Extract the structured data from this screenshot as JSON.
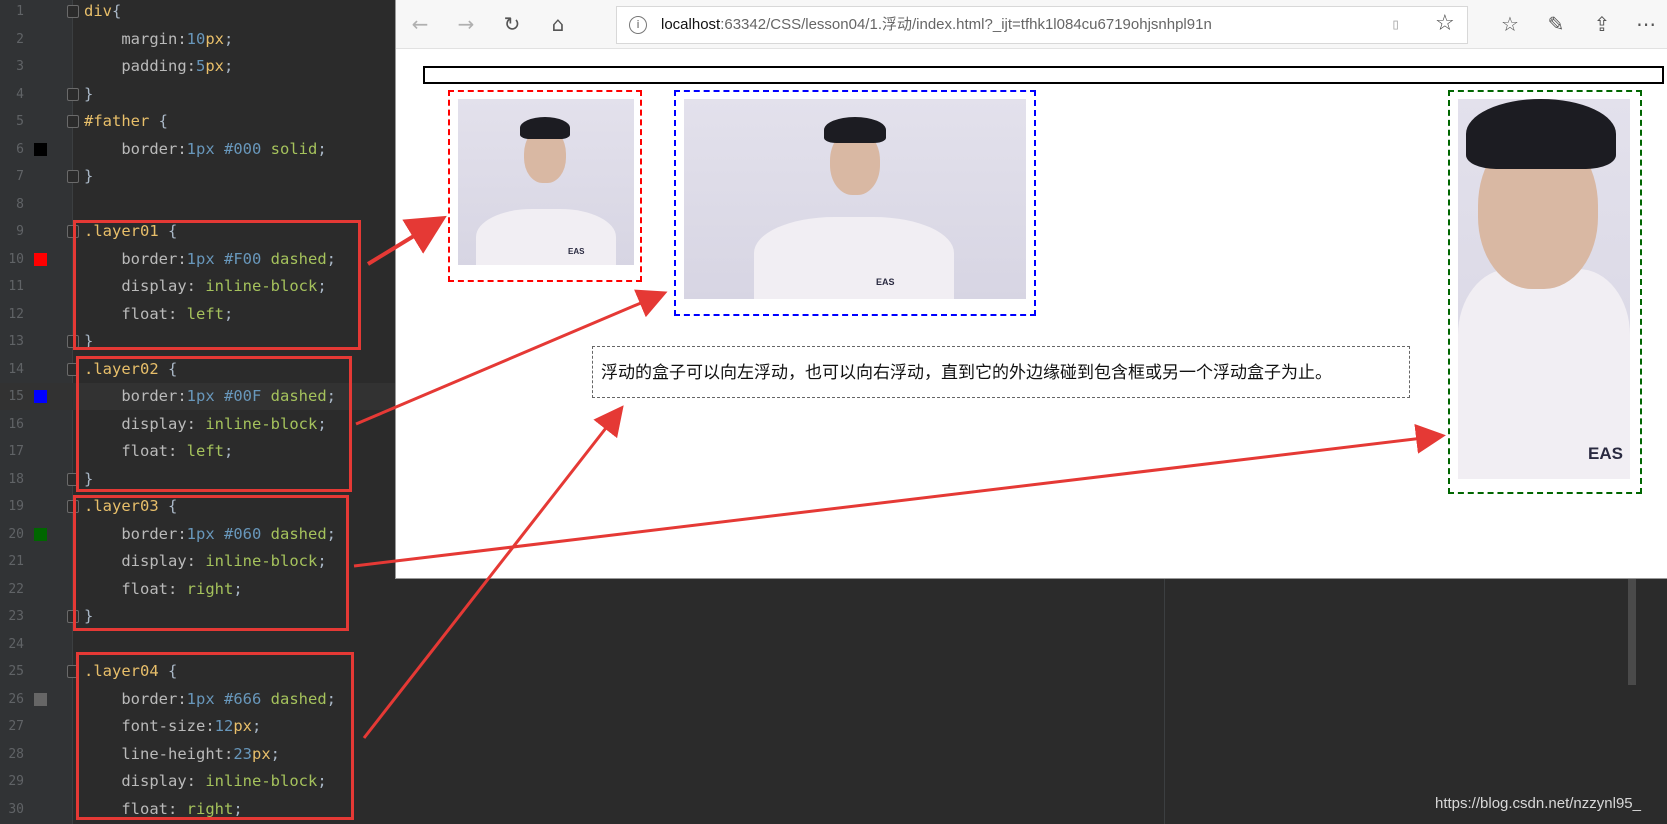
{
  "editor": {
    "lines": [
      {
        "n": "1",
        "parts": [
          [
            "kw",
            "div"
          ],
          [
            "",
            "{"
          ]
        ]
      },
      {
        "n": "2",
        "parts": [
          [
            "prop",
            "    margin:"
          ],
          [
            "num",
            "10"
          ],
          [
            "kw",
            "px"
          ],
          [
            "",
            ";"
          ]
        ]
      },
      {
        "n": "3",
        "parts": [
          [
            "prop",
            "    padding:"
          ],
          [
            "num",
            "5"
          ],
          [
            "kw",
            "px"
          ],
          [
            "",
            ";"
          ]
        ]
      },
      {
        "n": "4",
        "parts": [
          [
            "",
            "}"
          ]
        ]
      },
      {
        "n": "5",
        "parts": [
          [
            "sel",
            "#father"
          ],
          [
            "",
            " {"
          ]
        ]
      },
      {
        "n": "6",
        "parts": [
          [
            "prop",
            "    border:"
          ],
          [
            "num",
            "1px"
          ],
          [
            "",
            " "
          ],
          [
            "hex",
            "#000"
          ],
          [
            "",
            " "
          ],
          [
            "val",
            "solid"
          ],
          [
            "",
            ";"
          ]
        ]
      },
      {
        "n": "7",
        "parts": [
          [
            "",
            "}"
          ]
        ]
      },
      {
        "n": "8",
        "parts": []
      },
      {
        "n": "9",
        "parts": [
          [
            "sel",
            ".layer01"
          ],
          [
            "",
            " {"
          ]
        ]
      },
      {
        "n": "10",
        "parts": [
          [
            "prop",
            "    border:"
          ],
          [
            "num",
            "1px"
          ],
          [
            "",
            " "
          ],
          [
            "hex",
            "#F00"
          ],
          [
            "",
            " "
          ],
          [
            "val",
            "dashed"
          ],
          [
            "",
            ";"
          ]
        ]
      },
      {
        "n": "11",
        "parts": [
          [
            "prop",
            "    display: "
          ],
          [
            "val",
            "inline-block"
          ],
          [
            "",
            ";"
          ]
        ]
      },
      {
        "n": "12",
        "parts": [
          [
            "prop",
            "    float: "
          ],
          [
            "val",
            "left"
          ],
          [
            "",
            ";"
          ]
        ]
      },
      {
        "n": "13",
        "parts": [
          [
            "",
            "}"
          ]
        ]
      },
      {
        "n": "14",
        "parts": [
          [
            "sel",
            ".layer02"
          ],
          [
            "",
            " {"
          ]
        ]
      },
      {
        "n": "15",
        "parts": [
          [
            "prop",
            "    border:"
          ],
          [
            "num",
            "1px"
          ],
          [
            "",
            " "
          ],
          [
            "hex",
            "#00F"
          ],
          [
            "",
            " "
          ],
          [
            "val",
            "dashed"
          ],
          [
            "",
            ";"
          ]
        ]
      },
      {
        "n": "16",
        "parts": [
          [
            "prop",
            "    display: "
          ],
          [
            "val",
            "inline-block"
          ],
          [
            "",
            ";"
          ]
        ]
      },
      {
        "n": "17",
        "parts": [
          [
            "prop",
            "    float: "
          ],
          [
            "val",
            "left"
          ],
          [
            "",
            ";"
          ]
        ]
      },
      {
        "n": "18",
        "parts": [
          [
            "",
            "}"
          ]
        ]
      },
      {
        "n": "19",
        "parts": [
          [
            "sel",
            ".layer03"
          ],
          [
            "",
            " {"
          ]
        ]
      },
      {
        "n": "20",
        "parts": [
          [
            "prop",
            "    border:"
          ],
          [
            "num",
            "1px"
          ],
          [
            "",
            " "
          ],
          [
            "hex",
            "#060"
          ],
          [
            "",
            " "
          ],
          [
            "val",
            "dashed"
          ],
          [
            "",
            ";"
          ]
        ]
      },
      {
        "n": "21",
        "parts": [
          [
            "prop",
            "    display: "
          ],
          [
            "val",
            "inline-block"
          ],
          [
            "",
            ";"
          ]
        ]
      },
      {
        "n": "22",
        "parts": [
          [
            "prop",
            "    float: "
          ],
          [
            "val",
            "right"
          ],
          [
            "",
            ";"
          ]
        ]
      },
      {
        "n": "23",
        "parts": [
          [
            "",
            "}"
          ]
        ]
      },
      {
        "n": "24",
        "parts": []
      },
      {
        "n": "25",
        "parts": [
          [
            "sel",
            ".layer04"
          ],
          [
            "",
            " {"
          ]
        ]
      },
      {
        "n": "26",
        "parts": [
          [
            "prop",
            "    border:"
          ],
          [
            "num",
            "1px"
          ],
          [
            "",
            " "
          ],
          [
            "hex",
            "#666"
          ],
          [
            "",
            " "
          ],
          [
            "val",
            "dashed"
          ],
          [
            "",
            ";"
          ]
        ]
      },
      {
        "n": "27",
        "parts": [
          [
            "prop",
            "    font-size:"
          ],
          [
            "num",
            "12"
          ],
          [
            "kw",
            "px"
          ],
          [
            "",
            ";"
          ]
        ]
      },
      {
        "n": "28",
        "parts": [
          [
            "prop",
            "    line-height:"
          ],
          [
            "num",
            "23"
          ],
          [
            "kw",
            "px"
          ],
          [
            "",
            ";"
          ]
        ]
      },
      {
        "n": "29",
        "parts": [
          [
            "prop",
            "    display: "
          ],
          [
            "val",
            "inline-block"
          ],
          [
            "",
            ";"
          ]
        ]
      },
      {
        "n": "30",
        "parts": [
          [
            "prop",
            "    float: "
          ],
          [
            "val",
            "right"
          ],
          [
            "",
            ";"
          ]
        ]
      }
    ],
    "swatches": {
      "6": "#000000",
      "10": "#FF0000",
      "15": "#0000FF",
      "20": "#006600",
      "26": "#666666"
    }
  },
  "browser": {
    "back_icon": "back-arrow-icon",
    "forward_icon": "forward-arrow-icon",
    "refresh_icon": "refresh-icon",
    "home_icon": "home-icon",
    "url_host": "localhost",
    "url_rest": ":63342/CSS/lesson04/1.浮动/index.html?_ijt=tfhk1l084cu6719ohjsnhpl91n",
    "info_glyph": "i",
    "paragraph": "浮动的盒子可以向左浮动，也可以向右浮动，直到它的外边缘碰到包含框或另一个浮动盒子为止。",
    "photo_caption": "EAS"
  },
  "colors": {
    "layer01": "#FF0000",
    "layer02": "#0000FF",
    "layer03": "#006600",
    "layer04": "#666666",
    "annotation": "#E53935"
  },
  "watermark": "https://blog.csdn.net/nzzynl95_"
}
